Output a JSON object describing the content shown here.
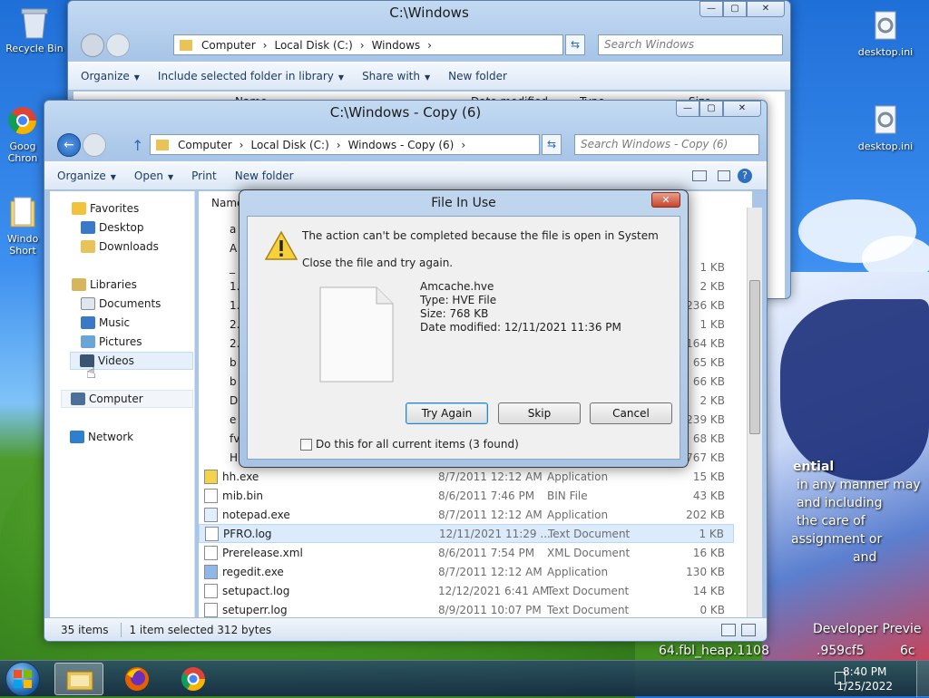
{
  "desktop": {
    "icons": [
      {
        "label": "Recycle Bin"
      },
      {
        "label": "Goog Chron"
      },
      {
        "label": "Windo Short"
      },
      {
        "label": "desktop.ini"
      },
      {
        "label": "desktop.ini"
      }
    ],
    "wallpaper_text": [
      "ential",
      "in any manner may",
      "and including",
      "the care of",
      "assignment or",
      "and",
      "Developer Previe",
      "64.fbl_heap.1108",
      ".959cf5",
      "6c"
    ]
  },
  "back_window": {
    "title": "C:\\Windows",
    "address": [
      "Computer",
      "Local Disk (C:)",
      "Windows"
    ],
    "search_placeholder": "Search Windows",
    "toolbar": {
      "organize": "Organize",
      "include": "Include selected folder in library",
      "share": "Share with",
      "new_folder": "New folder"
    },
    "col_name": "Name",
    "col_date": "Date modified",
    "col_type": "Type",
    "col_size": "Size",
    "nav_favorites": "Favorites",
    "nav_desktop": "Desktop"
  },
  "front_window": {
    "title": "C:\\Windows - Copy (6)",
    "address": [
      "Computer",
      "Local Disk (C:)",
      "Windows - Copy (6)"
    ],
    "search_placeholder": "Search Windows - Copy (6)",
    "toolbar": {
      "organize": "Organize",
      "open": "Open",
      "print": "Print",
      "new_folder": "New folder"
    },
    "col_name": "Name",
    "nav": {
      "favorites": "Favorites",
      "desktop": "Desktop",
      "downloads": "Downloads",
      "libraries": "Libraries",
      "documents": "Documents",
      "music": "Music",
      "pictures": "Pictures",
      "videos": "Videos",
      "computer": "Computer",
      "network": "Network"
    },
    "partial_names": [
      "a",
      "A",
      "_",
      "1.",
      "1.",
      "2.",
      "2.",
      "b",
      "b",
      "D",
      "e",
      "fv",
      "H"
    ],
    "partial_sizes": [
      "1 KB",
      "2 KB",
      "236 KB",
      "1 KB",
      "164 KB",
      "65 KB",
      "66 KB",
      "2 KB",
      "239 KB",
      "68 KB",
      "767 KB"
    ],
    "files": [
      {
        "name": "hh.exe",
        "date": "8/7/2011 12:12 AM",
        "type": "Application",
        "size": "15 KB"
      },
      {
        "name": "mib.bin",
        "date": "8/6/2011 7:46 PM",
        "type": "BIN File",
        "size": "43 KB"
      },
      {
        "name": "notepad.exe",
        "date": "8/7/2011 12:12 AM",
        "type": "Application",
        "size": "202 KB"
      },
      {
        "name": "PFRO.log",
        "date": "12/11/2021 11:29 ...",
        "type": "Text Document",
        "size": "1 KB"
      },
      {
        "name": "Prerelease.xml",
        "date": "8/6/2011 7:54 PM",
        "type": "XML Document",
        "size": "16 KB"
      },
      {
        "name": "regedit.exe",
        "date": "8/7/2011 12:12 AM",
        "type": "Application",
        "size": "130 KB"
      },
      {
        "name": "setupact.log",
        "date": "12/12/2021 6:41 AM",
        "type": "Text Document",
        "size": "14 KB"
      },
      {
        "name": "setuperr.log",
        "date": "8/9/2011 10:07 PM",
        "type": "Text Document",
        "size": "0 KB"
      }
    ],
    "status": {
      "count": "35 items",
      "selected": "1 item selected  312 bytes"
    }
  },
  "dialog": {
    "title": "File In Use",
    "message": "The action can't be completed because the file is open in System",
    "hint": "Close the file and try again.",
    "file_name": "Amcache.hve",
    "file_type": "Type: HVE File",
    "file_size": "Size: 768 KB",
    "file_date": "Date modified: 12/11/2021 11:36 PM",
    "try_again": "Try Again",
    "skip": "Skip",
    "cancel": "Cancel",
    "checkbox_label": "Do this for all current items (3 found)",
    "close_glyph": "✕"
  },
  "taskbar": {
    "time": "8:40 PM",
    "date": "1/25/2022"
  }
}
